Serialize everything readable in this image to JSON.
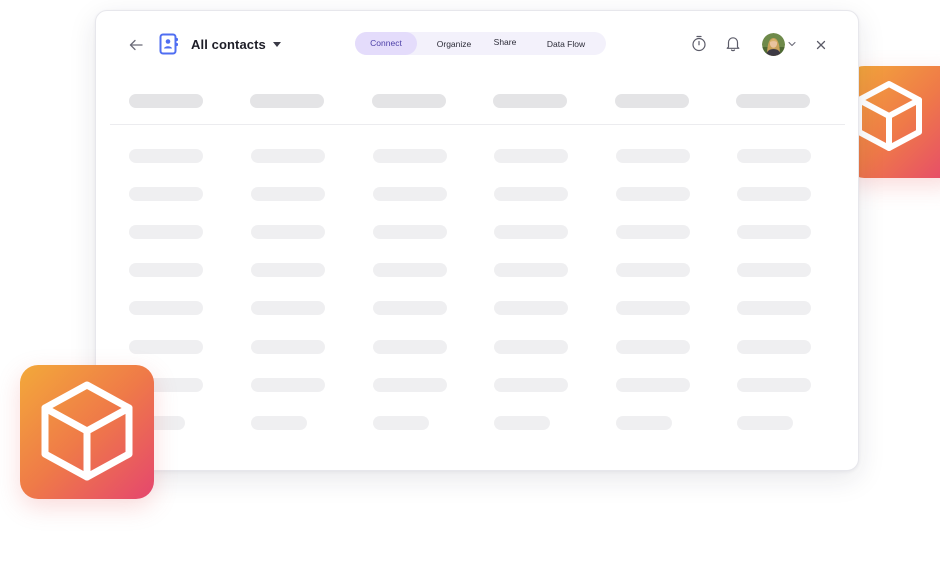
{
  "header": {
    "title": "All contacts",
    "tabs": [
      {
        "label": "Connect",
        "active": true
      },
      {
        "label": "Organize",
        "active": false
      },
      {
        "label": "Share",
        "active": false
      },
      {
        "label": "Data Flow",
        "active": false
      }
    ],
    "icons": {
      "back": "arrow-left-icon",
      "contacts": "contacts-book-icon",
      "timer": "stopwatch-icon",
      "notifications": "bell-icon",
      "avatar_caret": "chevron-down-icon",
      "close": "close-icon"
    }
  },
  "colors": {
    "accent": "#4f6ef2",
    "tab_active_bg": "#e4dcfb",
    "tab_group_bg": "#f3f1fb",
    "skeleton_header": "#e4e4e6",
    "skeleton_cell": "#efeff1",
    "app_icon_gradient": [
      "#f3a93a",
      "#ef7a48",
      "#e5466e"
    ]
  },
  "table": {
    "loading": true,
    "column_count": 6,
    "row_count": 8
  },
  "app_icons": [
    {
      "icon": "cube-icon"
    },
    {
      "icon": "cube-icon"
    }
  ]
}
